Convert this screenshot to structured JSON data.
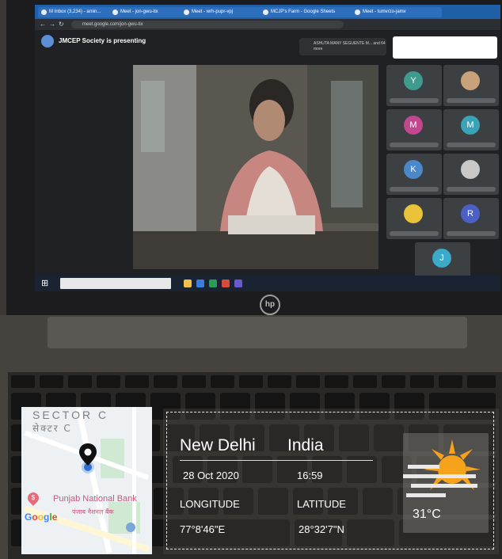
{
  "browser": {
    "tabs": [
      "M Inbox (3,234) - amin...",
      "Meet - jon-gwu-tix",
      "Meet - wrh-pupr-vpj",
      "MCJP's Farm - Google Sheets",
      "Meet - tumvrzo-jamv"
    ],
    "url": "meet.google.com/jon-gwu-tix"
  },
  "meet": {
    "presenting_text": "JMCEP Society is presenting",
    "participant_chip": "ASHUTA MANY SEGUENTE M... and 64 more",
    "participants": [
      {
        "initial": "Y",
        "color": "#3f9a8f"
      },
      {
        "initial": "",
        "color": "#c9a27a"
      },
      {
        "initial": "M",
        "color": "#c2478f"
      },
      {
        "initial": "M",
        "color": "#3aa3b5"
      },
      {
        "initial": "K",
        "color": "#4a88c9"
      },
      {
        "initial": "",
        "color": "#c8c8c8"
      },
      {
        "initial": "",
        "color": "#e8c33a"
      },
      {
        "initial": "R",
        "color": "#4b5fc4"
      },
      {
        "initial": "J",
        "color": "#3ba9c8"
      }
    ]
  },
  "laptop": {
    "brand_logo": "hp"
  },
  "map": {
    "area_en": "SECTOR C",
    "area_hi": "सेक्टर C",
    "poi_en": "Punjab National Bank",
    "poi_hi": "पंजाब नैशनल बैंक",
    "brand": "Google",
    "pin_icon": "location-pin-icon"
  },
  "location": {
    "city": "New Delhi",
    "country": "India",
    "date": "28 Oct 2020",
    "time": "16:59",
    "longitude_label": "LONGITUDE",
    "latitude_label": "LATITUDE",
    "longitude": "77°8'46\"E",
    "latitude": "28°32'7\"N"
  },
  "weather": {
    "icon": "sun-haze-icon",
    "temperature": "31°C"
  },
  "colors": {
    "pin": "#111111",
    "sun": "#f7a21b",
    "map_bank_text": "#c2597f"
  }
}
